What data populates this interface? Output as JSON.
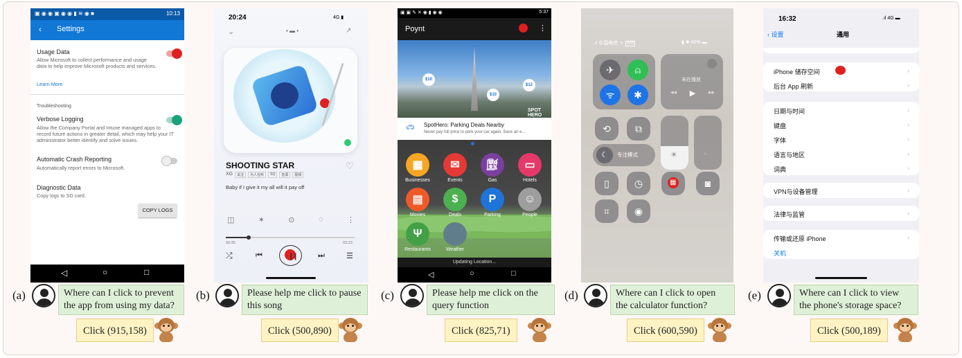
{
  "panels": [
    {
      "label": "(a)",
      "question": "Where can I click to prevent the app from using my data?",
      "answer": "Click (915,158)"
    },
    {
      "label": "(b)",
      "question": "Please help me click to pause this song",
      "answer": "Click (500,890)"
    },
    {
      "label": "(c)",
      "question": "Please help me click on the query function",
      "answer": "Click (825,71)"
    },
    {
      "label": "(d)",
      "question": "Where can I click to open the calculator function?",
      "answer": "Click (600,590)"
    },
    {
      "label": "(e)",
      "question": "Where can I click to view the phone's storage space?",
      "answer": "Click (500,189)"
    }
  ],
  "settings": {
    "time": "10:13",
    "title": "Settings",
    "usage_title": "Usage Data",
    "usage_desc": "Allow Microsoft to collect performance and usage data to help improve Microsoft products and services.",
    "learn_more": "Learn More",
    "troubleshooting": "Troubleshooting",
    "verbose_title": "Verbose Logging",
    "verbose_desc": "Allow the Company Portal and Intune managed apps to record future actions in greater detail, which may help your IT administrator better identify and solve issues.",
    "crash_title": "Automatic Crash Reporting",
    "crash_desc": "Automatically report errors to Microsoft.",
    "diag_title": "Diagnostic Data",
    "diag_desc": "Copy logs to SD card.",
    "copy_logs": "COPY LOGS",
    "accent": "#1178d6",
    "toggle_on": "#1aa37a",
    "tap_marker": "#e02020"
  },
  "music": {
    "time": "20:24",
    "signal": "4G",
    "song": "SHOOTING STAR",
    "artist": "XG",
    "tags": [
      "关注",
      "为人在听",
      "SQ",
      "音源",
      "视频"
    ],
    "lyric": "Baby if I give it my all will it pay off",
    "t_start": "00:35",
    "t_end": "03:23",
    "like_count": "999+",
    "marker_color": "#e02020"
  },
  "poynt": {
    "time": "5:37",
    "app_title": "Poynt",
    "prices": [
      "$10",
      "$10",
      "$12"
    ],
    "brand": "SPOT HERO",
    "promo_title": "SpotHero: Parking Deals Nearby",
    "promo_desc": "Never pay full price to park your car again. Save an e...",
    "cats": [
      "Businesses",
      "Events",
      "Gas",
      "Hotels",
      "Movies",
      "Deals",
      "Parking",
      "People",
      "Restaurants",
      "Weather"
    ],
    "updating": "Updating Location...",
    "colors": {
      "topbar": "#1a1a1a",
      "businesses": "#f5a623",
      "events": "#e53935",
      "gas": "#7b3fa0",
      "hotels": "#e5396b",
      "movies": "#f05a28",
      "deals": "#4caf50",
      "parking": "#1e74d8",
      "people": "#9e9e9e",
      "restaurants": "#43a047",
      "weather": "#607d8b"
    }
  },
  "control": {
    "carrier": "中国电信",
    "vpn": "VPN",
    "battery": "86%",
    "now_playing": "未在播放",
    "focus": "专注模式",
    "marker_color": "#e02020"
  },
  "ios": {
    "time": "16:32",
    "signal": "4G",
    "back": "设置",
    "title": "通用",
    "group1": [
      "iPhone 储存空间",
      "后台 App 刷新"
    ],
    "group2": [
      "日期与时间",
      "键盘",
      "字体",
      "语言与地区",
      "词典"
    ],
    "group3": [
      "VPN与设备管理"
    ],
    "group4": [
      "法律与监管"
    ],
    "group5": [
      "传输或还原 iPhone"
    ],
    "shutdown": "关机",
    "link_color": "#0a7aff",
    "marker_color": "#e02020"
  }
}
